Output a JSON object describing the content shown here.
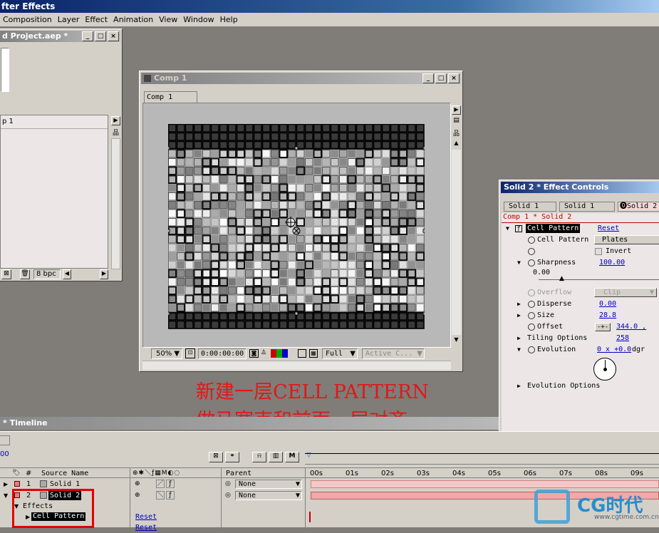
{
  "app": {
    "title": "fter Effects"
  },
  "menu": [
    "Composition",
    "Layer",
    "Effect",
    "Animation",
    "View",
    "Window",
    "Help"
  ],
  "project": {
    "title": "d Project.aep *",
    "item": "p 1",
    "bpc": "8 bpc"
  },
  "comp": {
    "title": "Comp 1",
    "tab": "Comp 1",
    "zoom": "50%",
    "timecode": "0:00:00:00",
    "resolution": "Full",
    "camera": "Active C..."
  },
  "effect_controls": {
    "title": "Solid 2 * Effect Controls",
    "tabs": [
      "Solid 1",
      "Solid 1",
      "Solid 2"
    ],
    "breadcrumb": "Comp 1 * Solid 2",
    "effect_name": "Cell Pattern",
    "reset": "Reset",
    "cell_pattern_label": "Cell Pattern",
    "cell_pattern_value": "Plates",
    "invert_label": "Invert",
    "sharpness_label": "Sharpness",
    "sharpness_value": "100.00",
    "sharpness_min": "0.00",
    "overflow_label": "Overflow",
    "overflow_value": "Clip",
    "disperse_label": "Disperse",
    "disperse_value": "0.00",
    "size_label": "Size",
    "size_value": "28.8",
    "offset_label": "Offset",
    "offset_value": "344.0 , 258",
    "tiling_label": "Tiling Options",
    "evolution_label": "Evolution",
    "evolution_value": "0 x +0.0",
    "evolution_unit": "dgr",
    "evo_options_label": "Evolution Options"
  },
  "annotation": {
    "line1": "新建一层CELL PATTERN",
    "line2": "做马塞克和前面一层对齐"
  },
  "timeline": {
    "title": "* Timeline",
    "col_source": "Source Name",
    "col_parent": "Parent",
    "ruler": [
      "00s",
      "01s",
      "02s",
      "03s",
      "04s",
      "05s",
      "06s",
      "07s",
      "08s",
      "09s"
    ],
    "layers": [
      {
        "num": "1",
        "name": "Solid 1",
        "parent": "None"
      },
      {
        "num": "2",
        "name": "Solid 2",
        "parent": "None"
      }
    ],
    "effects_label": "Effects",
    "effect_item": "Cell Pattern",
    "reset1": "Reset",
    "reset2": "Reset"
  },
  "watermark": {
    "brand": "CG时代",
    "url": "www.cgtime.com.cn"
  },
  "colors": {
    "accent_red": "#e01818",
    "layer_bar": "#f0a8a8",
    "title_blue": "#0a246a"
  }
}
